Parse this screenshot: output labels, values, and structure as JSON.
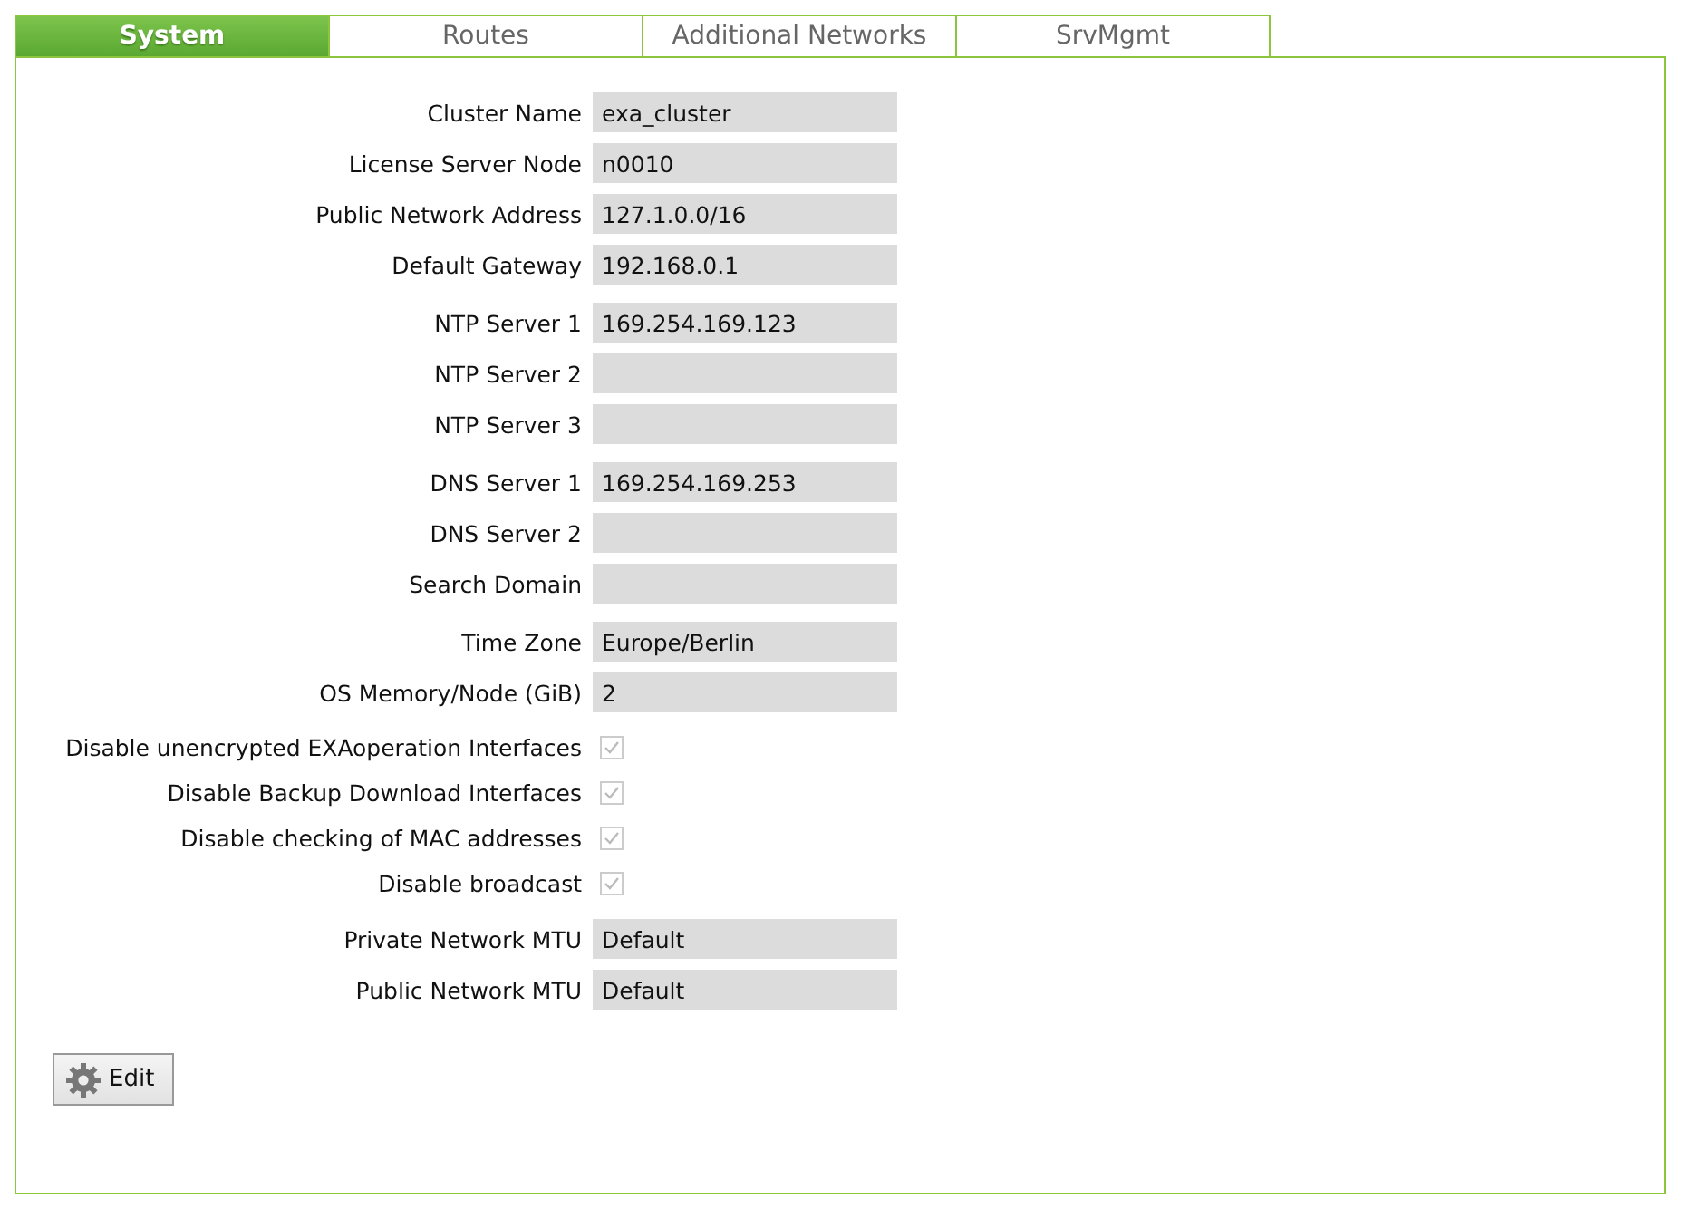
{
  "tabs": [
    {
      "label": "System",
      "selected": true
    },
    {
      "label": "Routes",
      "selected": false
    },
    {
      "label": "Additional Networks",
      "selected": false
    },
    {
      "label": "SrvMgmt",
      "selected": false
    }
  ],
  "sections": [
    {
      "rows": [
        {
          "kind": "field",
          "label": "Cluster Name",
          "value": "exa_cluster"
        },
        {
          "kind": "field",
          "label": "License Server Node",
          "value": "n0010"
        },
        {
          "kind": "field",
          "label": "Public Network Address",
          "value": "127.1.0.0/16"
        },
        {
          "kind": "field",
          "label": "Default Gateway",
          "value": "192.168.0.1"
        }
      ]
    },
    {
      "rows": [
        {
          "kind": "field",
          "label": "NTP Server 1",
          "value": "169.254.169.123"
        },
        {
          "kind": "field",
          "label": "NTP Server 2"
        },
        {
          "kind": "field",
          "label": "NTP Server 3"
        }
      ]
    },
    {
      "rows": [
        {
          "kind": "field",
          "label": "DNS Server 1",
          "value": "169.254.169.253"
        },
        {
          "kind": "field",
          "label": "DNS Server 2"
        },
        {
          "kind": "field",
          "label": "Search Domain"
        }
      ]
    },
    {
      "rows": [
        {
          "kind": "field",
          "label": "Time Zone",
          "value": "Europe/Berlin"
        },
        {
          "kind": "field",
          "label": "OS Memory/Node (GiB)",
          "value": "2"
        }
      ]
    },
    {
      "rows": [
        {
          "kind": "checkbox",
          "label": "Disable unencrypted EXAoperation Interfaces",
          "checked": true,
          "disabled": true
        },
        {
          "kind": "checkbox",
          "label": "Disable Backup Download Interfaces",
          "checked": true,
          "disabled": true
        },
        {
          "kind": "checkbox",
          "label": "Disable checking of MAC addresses",
          "checked": true,
          "disabled": true
        },
        {
          "kind": "checkbox",
          "label": "Disable broadcast",
          "checked": true,
          "disabled": true
        }
      ]
    },
    {
      "rows": [
        {
          "kind": "field",
          "label": "Private Network MTU",
          "value": "Default"
        },
        {
          "kind": "field",
          "label": "Public Network MTU",
          "value": "Default"
        }
      ]
    }
  ],
  "edit_button": "Edit"
}
